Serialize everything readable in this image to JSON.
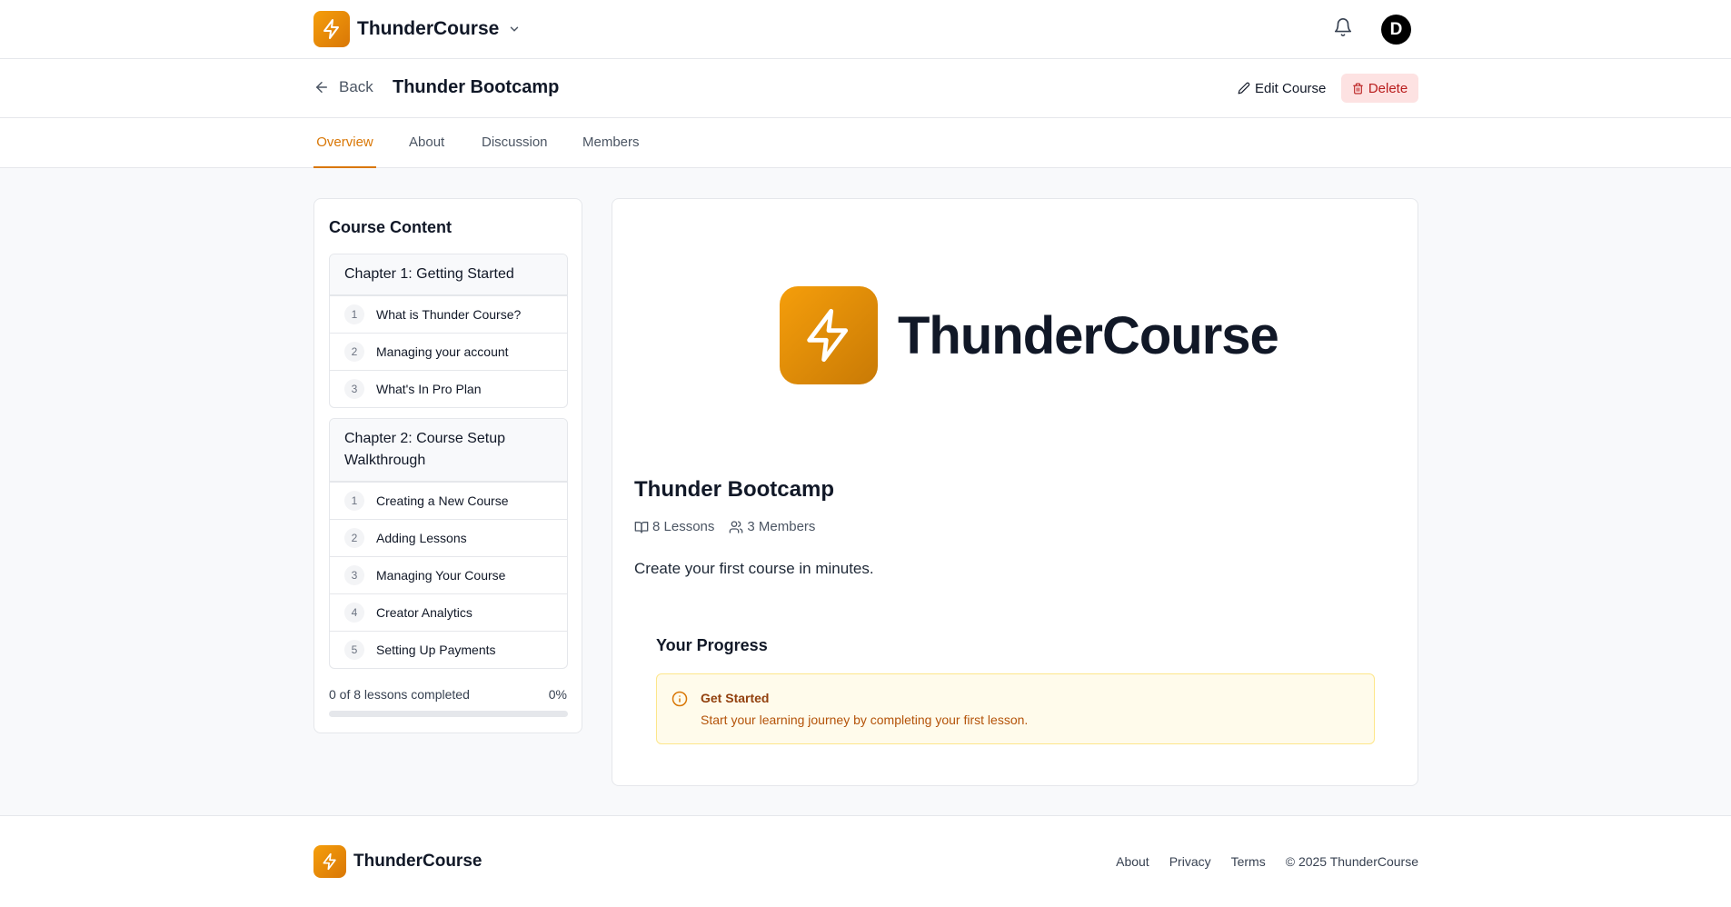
{
  "app": {
    "brand_name": "ThunderCourse",
    "avatar_initial": "D"
  },
  "header": {
    "back_label": "Back",
    "page_title": "Thunder Bootcamp",
    "edit_label": "Edit Course",
    "delete_label": "Delete"
  },
  "tabs": [
    {
      "label": "Overview",
      "active": true
    },
    {
      "label": "About",
      "active": false
    },
    {
      "label": "Discussion",
      "active": false
    },
    {
      "label": "Members",
      "active": false
    }
  ],
  "sidebar": {
    "title": "Course Content",
    "chapters": [
      {
        "title": "Chapter 1: Getting Started",
        "lessons": [
          {
            "num": "1",
            "title": "What is Thunder Course?"
          },
          {
            "num": "2",
            "title": "Managing your account"
          },
          {
            "num": "3",
            "title": "What's In Pro Plan"
          }
        ]
      },
      {
        "title": "Chapter 2: Course Setup Walkthrough",
        "lessons": [
          {
            "num": "1",
            "title": "Creating a New Course"
          },
          {
            "num": "2",
            "title": "Adding Lessons"
          },
          {
            "num": "3",
            "title": "Managing Your Course"
          },
          {
            "num": "4",
            "title": "Creator Analytics"
          },
          {
            "num": "5",
            "title": "Setting Up Payments"
          }
        ]
      }
    ],
    "progress_text": "0 of 8 lessons completed",
    "progress_pct": "0%",
    "progress_value": 0
  },
  "course": {
    "hero_name": "ThunderCourse",
    "title": "Thunder Bootcamp",
    "lessons_count": "8 Lessons",
    "members_count": "3 Members",
    "description": "Create your first course in minutes.",
    "progress_heading": "Your Progress",
    "alert_title": "Get Started",
    "alert_text": "Start your learning journey by completing your first lesson."
  },
  "footer": {
    "brand_name": "ThunderCourse",
    "links": [
      "About",
      "Privacy",
      "Terms"
    ],
    "copyright": "© 2025 ThunderCourse"
  },
  "colors": {
    "accent": "#d97706",
    "danger_bg": "#fde2e2",
    "danger_text": "#b91c1c",
    "alert_bg": "#fffbeb"
  },
  "icons": [
    "bolt-icon",
    "chevron-down-icon",
    "bell-icon",
    "arrow-left-icon",
    "pencil-icon",
    "trash-icon",
    "book-icon",
    "users-icon",
    "info-icon"
  ]
}
